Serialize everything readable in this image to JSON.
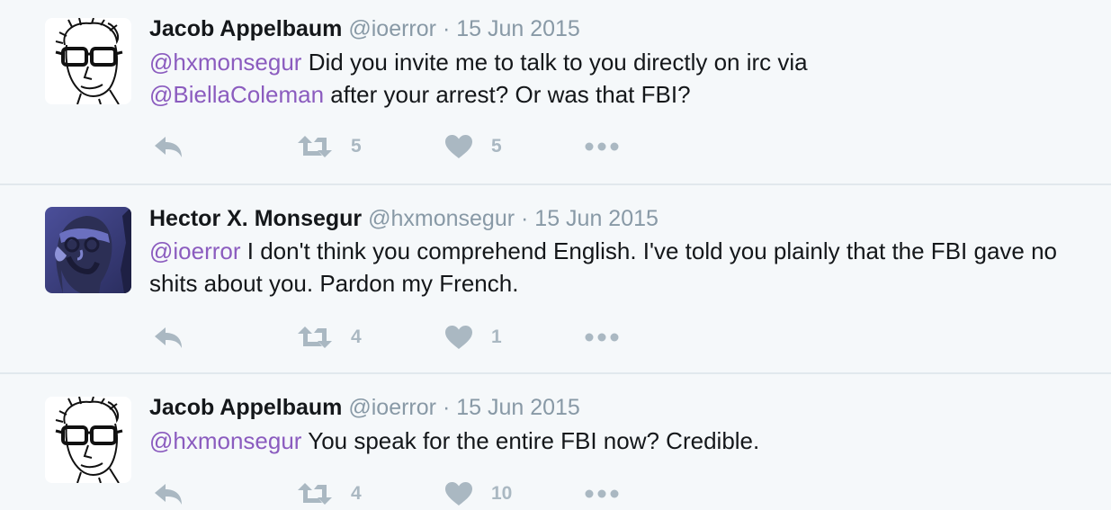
{
  "tweets": [
    {
      "name": "Jacob Appelbaum",
      "handle": "@ioerror",
      "sep": "·",
      "date": "15 Jun 2015",
      "mention1": "@hxmonsegur",
      "text1": " Did you invite me to talk to you directly on irc via ",
      "mention2": "@BiellaColeman",
      "text2": " after your arrest? Or was that FBI?",
      "retweets": "5",
      "likes": "5",
      "avatar": "sketch-portrait-glasses"
    },
    {
      "name": "Hector X. Monsegur",
      "handle": "@hxmonsegur",
      "sep": "·",
      "date": "15 Jun 2015",
      "mention1": "@ioerror",
      "text1": " I don't think you comprehend English. I've told you plainly that the FBI gave no shits about you. Pardon my French.",
      "retweets": "4",
      "likes": "1",
      "avatar": "blue-tinted-portrait"
    },
    {
      "name": "Jacob Appelbaum",
      "handle": "@ioerror",
      "sep": "·",
      "date": "15 Jun 2015",
      "mention1": "@hxmonsegur",
      "text1": " You speak for the entire FBI now? Credible.",
      "retweets": "4",
      "likes": "10",
      "avatar": "sketch-portrait-glasses"
    }
  ],
  "colors": {
    "background": "#f5f8fa",
    "mention": "#8b5cbf",
    "muted": "#8899a6",
    "icon": "#aab8c2",
    "divider": "#e1e8ed"
  }
}
